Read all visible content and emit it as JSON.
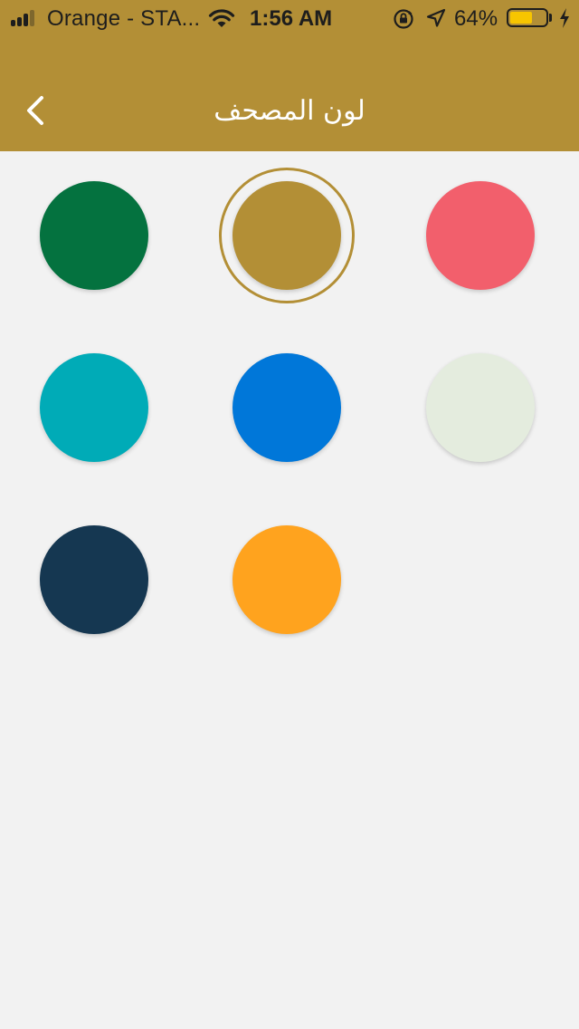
{
  "status_bar": {
    "carrier": "Orange - STA...",
    "time": "1:56 AM",
    "battery_percent": "64%",
    "battery_level": 0.64,
    "signal_bars": 3,
    "icons": [
      "signal-icon",
      "wifi-icon",
      "rotation-lock-icon",
      "location-icon",
      "battery-icon",
      "charging-bolt-icon"
    ]
  },
  "header": {
    "title": "لون المصحف",
    "back_icon": "chevron-left-icon",
    "background_color": "#b38f36"
  },
  "swatches": [
    {
      "color": "#04723f",
      "selected": false
    },
    {
      "color": "#b38f36",
      "selected": true
    },
    {
      "color": "#f25f6c",
      "selected": false
    },
    {
      "color": "#00abb7",
      "selected": false
    },
    {
      "color": "#0077d9",
      "selected": false
    },
    {
      "color": "#e4ecde",
      "selected": false
    },
    {
      "color": "#153751",
      "selected": false
    },
    {
      "color": "#ffa31e",
      "selected": false
    }
  ]
}
